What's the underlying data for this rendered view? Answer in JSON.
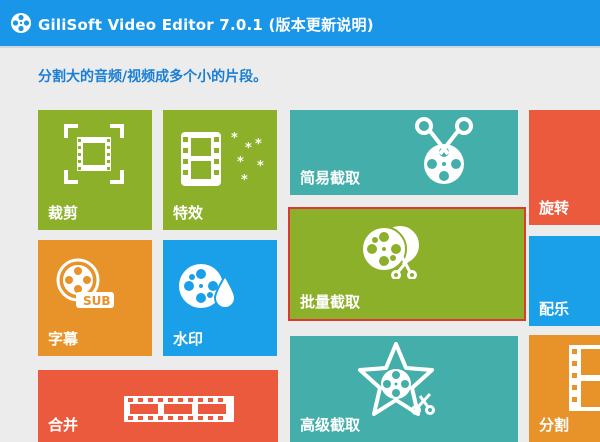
{
  "window": {
    "title": "GiliSoft Video Editor 7.0.1 (版本更新说明)",
    "app_icon": "film-reel-icon"
  },
  "main": {
    "subtitle": "分割大的音频/视频成多个小的片段。"
  },
  "tiles": {
    "crop": {
      "label": "裁剪",
      "icon": "crop-frame-icon",
      "color": "#8cb02a"
    },
    "effects": {
      "label": "特效",
      "icon": "film-effects-icon",
      "color": "#8cb02a"
    },
    "simple_cut": {
      "label": "简易截取",
      "icon": "scissors-reel-icon",
      "color": "#44aeaa"
    },
    "rotate": {
      "label": "旋转",
      "icon": "",
      "color": "#eb5a3c"
    },
    "subtitle": {
      "label": "字幕",
      "icon": "sub-reel-icon",
      "color": "#e8932a"
    },
    "watermark": {
      "label": "水印",
      "icon": "reel-drop-icon",
      "color": "#1aa0e8"
    },
    "batch_cut": {
      "label": "批量截取",
      "icon": "reels-scissors-icon",
      "color": "#8cb02a",
      "selected": true
    },
    "dub": {
      "label": "配乐",
      "icon": "",
      "color": "#1aa0e8"
    },
    "merge": {
      "label": "合并",
      "icon": "film-strip-icon",
      "color": "#eb5a3c"
    },
    "advanced_cut": {
      "label": "高级截取",
      "icon": "star-reel-icon",
      "color": "#44aeaa"
    },
    "split": {
      "label": "分割",
      "icon": "film-strip-icon",
      "color": "#e8932a"
    }
  }
}
